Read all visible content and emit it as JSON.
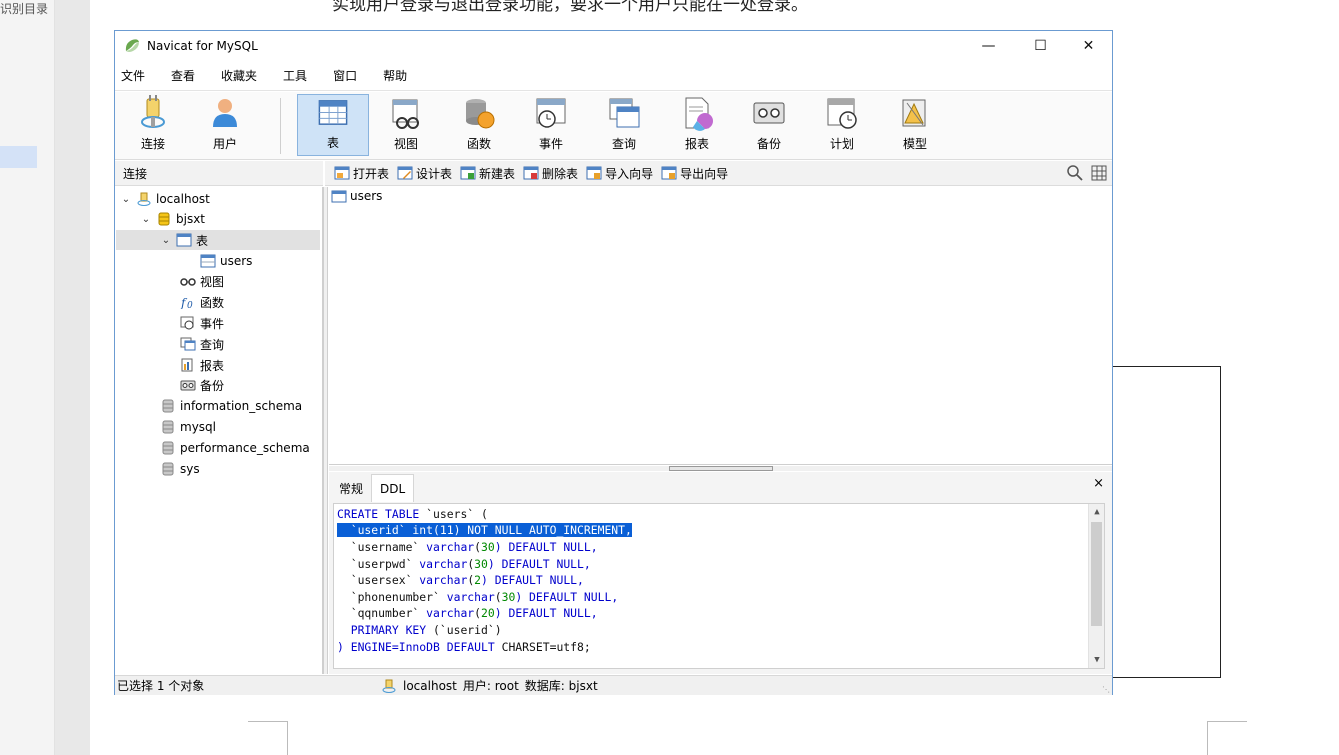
{
  "document": {
    "toc_label": "识别目录",
    "heading": "实现用户登录与退出登录功能，要求一个用户只能在一处登录。"
  },
  "window": {
    "title": "Navicat for MySQL",
    "controls": {
      "minimize": "—",
      "maximize": "☐",
      "close": "✕"
    }
  },
  "menu": [
    "文件",
    "查看",
    "收藏夹",
    "工具",
    "窗口",
    "帮助"
  ],
  "toolbar": {
    "connect": "连接",
    "user": "用户",
    "table": "表",
    "view": "视图",
    "function": "函数",
    "event": "事件",
    "query": "查询",
    "report": "报表",
    "backup": "备份",
    "schedule": "计划",
    "model": "模型"
  },
  "connection_header": "连接",
  "object_toolbar": {
    "open": "打开表",
    "design": "设计表",
    "new": "新建表",
    "delete": "删除表",
    "import": "导入向导",
    "export": "导出向导"
  },
  "tree": {
    "localhost": "localhost",
    "bjsxt": "bjsxt",
    "tables": "表",
    "users": "users",
    "views": "视图",
    "functions": "函数",
    "events": "事件",
    "queries": "查询",
    "reports": "报表",
    "backups": "备份",
    "db_information_schema": "information_schema",
    "db_mysql": "mysql",
    "db_performance_schema": "performance_schema",
    "db_sys": "sys"
  },
  "object_list": [
    "users"
  ],
  "info_panel": {
    "tab_general": "常规",
    "tab_ddl": "DDL",
    "close": "×"
  },
  "ddl": {
    "l1a": "CREATE TABLE",
    "l1b": " `users` (",
    "l2": "  `userid` int(11) NOT NULL AUTO_INCREMENT,",
    "l3a": "  `username` ",
    "l3b": "varchar",
    "l3c": "(",
    "l3d": "30",
    "l3e": ") DEFAULT NULL,",
    "l4a": "  `userpwd` ",
    "l4b": "varchar",
    "l4c": "(",
    "l4d": "30",
    "l4e": ") DEFAULT NULL,",
    "l5a": "  `usersex` ",
    "l5b": "varchar",
    "l5c": "(",
    "l5d": "2",
    "l5e": ") DEFAULT NULL,",
    "l6a": "  `phonenumber` ",
    "l6b": "varchar",
    "l6c": "(",
    "l6d": "30",
    "l6e": ") DEFAULT NULL,",
    "l7a": "  `qqnumber` ",
    "l7b": "varchar",
    "l7c": "(",
    "l7d": "20",
    "l7e": ") DEFAULT NULL,",
    "l8a": "  PRIMARY KEY",
    "l8b": " (`userid`)",
    "l9a": ") ENGINE=InnoDB DEFAULT",
    "l9b": " CHARSET=utf8;"
  },
  "status": {
    "selection": "已选择 1 个对象",
    "connection": "localhost",
    "user": "用户: root",
    "database": "数据库: bjsxt"
  },
  "colors": {
    "accent": "#0a5fd6",
    "toolbar_active": "#cfe3f7",
    "keyword": "#0000cc",
    "number": "#008800"
  }
}
